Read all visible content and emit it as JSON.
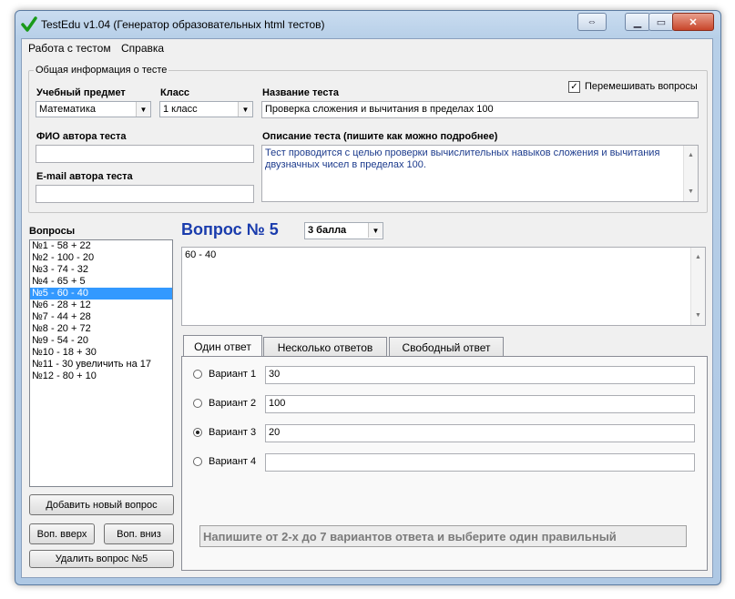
{
  "window": {
    "title": "TestEdu v1.04 (Генератор образовательных html тестов)",
    "buttons": [
      "back-arrows",
      "minimize",
      "maximize",
      "close"
    ]
  },
  "menu": [
    "Работа с тестом",
    "Справка"
  ],
  "info": {
    "legend": "Общая информация о тесте",
    "shuffle_label": "Перемешивать вопросы",
    "shuffle_checked": true,
    "subject_label": "Учебный предмет",
    "subject_value": "Математика",
    "class_label": "Класс",
    "class_value": "1 класс",
    "test_name_label": "Название теста",
    "test_name_value": "Проверка сложения и вычитания в пределах 100",
    "author_label": "ФИО автора теста",
    "author_value": "",
    "email_label": "E-mail автора теста",
    "email_value": "",
    "desc_label": "Описание теста (пишите как можно подробнее)",
    "desc_value": "Тест проводится с целью проверки вычислительных навыков сложения и вычитания двузначных чисел в пределах 100."
  },
  "questions": {
    "label": "Вопросы",
    "items": [
      "№1 - 58 + 22",
      "№2 - 100 - 20",
      "№3 - 74 - 32",
      "№4 - 65 + 5",
      "№5 - 60 - 40",
      "№6 - 28 + 12",
      "№7 - 44 + 28",
      "№8 - 20 + 72",
      "№9 - 54 - 20",
      "№10 - 18 + 30",
      "№11 - 30 увеличить на 17",
      "№12 - 80 + 10"
    ],
    "selected_index": 4,
    "add_button": "Добавить новый вопрос",
    "up_button": "Воп. вверх",
    "down_button": "Воп. вниз",
    "delete_button": "Удалить вопрос №5"
  },
  "question": {
    "title": "Вопрос № 5",
    "points": "3 балла",
    "text": "60 - 40"
  },
  "tabs": [
    "Один ответ",
    "Несколько ответов",
    "Свободный ответ"
  ],
  "active_tab": 0,
  "answers": [
    {
      "label": "Вариант 1",
      "value": "30",
      "selected": false
    },
    {
      "label": "Вариант 2",
      "value": "100",
      "selected": false
    },
    {
      "label": "Вариант 3",
      "value": "20",
      "selected": true
    },
    {
      "label": "Вариант 4",
      "value": "",
      "selected": false
    }
  ],
  "hint": "Напишите от 2-х до 7 вариантов ответа и выберите один правильный"
}
